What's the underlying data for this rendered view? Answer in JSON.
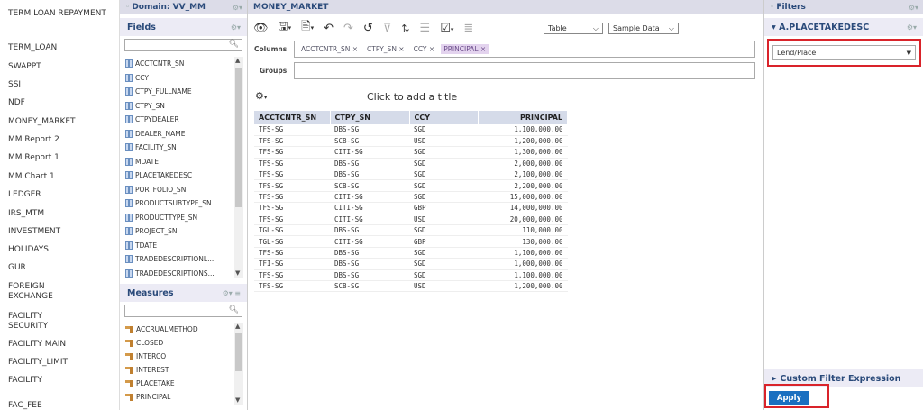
{
  "left_nav": [
    "TERM LOAN REPAYMENT",
    "TERM_LOAN",
    "SWAPPT",
    "SSI",
    "NDF",
    "MONEY_MARKET",
    "MM Report 2",
    "MM Report 1",
    "MM Chart 1",
    "LEDGER",
    "IRS_MTM",
    "INVESTMENT",
    "HOLIDAYS",
    "GUR",
    "FOREIGN EXCHANGE",
    "FACILITY SECURITY",
    "FACILITY MAIN",
    "FACILITY_LIMIT",
    "FACILITY",
    "FAC_FEE"
  ],
  "domain": {
    "title": "Domain: VV_MM"
  },
  "fields": {
    "title": "Fields",
    "items": [
      "ACCTCNTR_SN",
      "CCY",
      "CTPY_FULLNAME",
      "CTPY_SN",
      "CTPYDEALER",
      "DEALER_NAME",
      "FACILITY_SN",
      "MDATE",
      "PLACETAKEDESC",
      "PORTFOLIO_SN",
      "PRODUCTSUBTYPE_SN",
      "PRODUCTTYPE_SN",
      "PROJECT_SN",
      "TDATE",
      "TRADEDESCRIPTIONL...",
      "TRADEDESCRIPTIONS..."
    ]
  },
  "measures": {
    "title": "Measures",
    "items": [
      "ACCRUALMETHOD",
      "CLOSED",
      "INTERCO",
      "INTEREST",
      "PLACETAKE",
      "PRINCIPAL"
    ]
  },
  "main": {
    "title": "MONEY_MARKET",
    "view_select": "Table",
    "data_select": "Sample Data",
    "columns_label": "Columns",
    "groups_label": "Groups",
    "column_pills": [
      "ACCTCNTR_SN ×",
      "CTPY_SN ×",
      "CCY ×",
      "PRINCIPAL ×"
    ],
    "add_title": "Click to add a title"
  },
  "table": {
    "headers": [
      "ACCTCNTR_SN",
      "CTPY_SN",
      "CCY",
      "PRINCIPAL"
    ],
    "rows": [
      [
        "TFS-SG",
        "DBS-SG",
        "SGD",
        "1,100,000.00"
      ],
      [
        "TFS-SG",
        "SCB-SG",
        "USD",
        "1,200,000.00"
      ],
      [
        "TFS-SG",
        "CITI-SG",
        "SGD",
        "1,300,000.00"
      ],
      [
        "TFS-SG",
        "DBS-SG",
        "SGD",
        "2,000,000.00"
      ],
      [
        "TFS-SG",
        "DBS-SG",
        "SGD",
        "2,100,000.00"
      ],
      [
        "TFS-SG",
        "SCB-SG",
        "SGD",
        "2,200,000.00"
      ],
      [
        "TFS-SG",
        "CITI-SG",
        "SGD",
        "15,000,000.00"
      ],
      [
        "TFS-SG",
        "CITI-SG",
        "GBP",
        "14,000,000.00"
      ],
      [
        "TFS-SG",
        "CITI-SG",
        "USD",
        "20,000,000.00"
      ],
      [
        "TGL-SG",
        "DBS-SG",
        "SGD",
        "110,000.00"
      ],
      [
        "TGL-SG",
        "CITI-SG",
        "GBP",
        "130,000.00"
      ],
      [
        "TFS-SG",
        "DBS-SG",
        "SGD",
        "1,100,000.00"
      ],
      [
        "TFI-SG",
        "DBS-SG",
        "SGD",
        "1,000,000.00"
      ],
      [
        "TFS-SG",
        "DBS-SG",
        "SGD",
        "1,100,000.00"
      ],
      [
        "TFS-SG",
        "SCB-SG",
        "USD",
        "1,200,000.00"
      ]
    ]
  },
  "filters": {
    "title": "Filters",
    "filter_name": "A.PLACETAKEDESC",
    "selected": "Lend/Place",
    "custom": "Custom Filter Expression",
    "apply": "Apply"
  }
}
